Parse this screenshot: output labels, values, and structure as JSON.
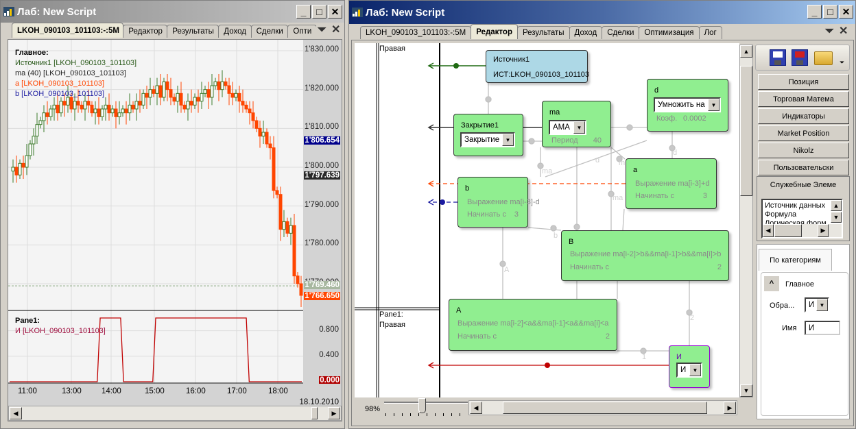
{
  "left_window": {
    "title": "Лаб: New Script",
    "tabs": [
      "LKOH_090103_101103:-:5M",
      "Редактор",
      "Результаты",
      "Доход",
      "Сделки",
      "Опти"
    ],
    "active_tab": 0,
    "legend_main": {
      "title": "Главное:",
      "items": [
        "Источник1 [LKOH_090103_101103]",
        "ma (40) [LKOH_090103_101103]",
        "a [LKOH_090103_101103]",
        "b [LKOH_090103_101103]"
      ]
    },
    "legend_pane1": {
      "title": "Pane1:",
      "items": [
        "И [LKOH_090103_101103]"
      ]
    },
    "price_labels": [
      "1'830.000",
      "1'820.000",
      "1'810.000",
      "1'800.000",
      "1'790.000",
      "1'780.000",
      "1'770.000"
    ],
    "price_levels": [
      1830,
      1820,
      1810,
      1800,
      1790,
      1780,
      1770
    ],
    "price_tags": [
      {
        "text": "1'806.654",
        "bg": "#00008b",
        "value": 1806.654
      },
      {
        "text": "1'797.639",
        "bg": "#2a2a2a",
        "value": 1797.639
      },
      {
        "text": "1'769.460",
        "bg": "#a8b8a0",
        "value": 1769.46
      },
      {
        "text": "1'766.650",
        "bg": "#ff4500",
        "value": 1766.65
      }
    ],
    "pane1_labels": [
      "0.800",
      "0.400"
    ],
    "pane1_tag": "0.000",
    "time_labels": [
      "11:00",
      "13:00",
      "14:00",
      "15:00",
      "16:00",
      "17:00",
      "18:00"
    ],
    "date_label": "18.10.2010",
    "closes": [
      1799,
      1800,
      1798,
      1801,
      1800,
      1803,
      1806,
      1808,
      1811,
      1812,
      1814,
      1813,
      1815,
      1816,
      1814,
      1817,
      1816,
      1818,
      1815,
      1817,
      1816,
      1815,
      1817,
      1816,
      1814,
      1815,
      1813,
      1815,
      1816,
      1814,
      1815,
      1813,
      1814,
      1815,
      1814,
      1816,
      1815,
      1817,
      1816,
      1819,
      1818,
      1820,
      1819,
      1821,
      1818,
      1822,
      1820,
      1818,
      1817,
      1819,
      1816,
      1815,
      1817,
      1816,
      1818,
      1817,
      1819,
      1820,
      1818,
      1821,
      1822,
      1820,
      1822,
      1821,
      1819,
      1818,
      1819,
      1817,
      1816,
      1815,
      1814,
      1812,
      1810,
      1808,
      1809,
      1806,
      1805,
      1794,
      1793,
      1784,
      1786,
      1783,
      1785,
      1772,
      1770,
      1767
    ],
    "signal": [
      [
        0,
        0
      ],
      [
        0.3,
        0
      ],
      [
        0.31,
        1
      ],
      [
        0.38,
        1
      ],
      [
        0.39,
        0
      ],
      [
        0.49,
        0
      ],
      [
        0.5,
        1
      ],
      [
        0.81,
        1
      ],
      [
        0.82,
        0
      ],
      [
        1,
        0
      ]
    ],
    "colors": {
      "up": "#3a7a2a",
      "down": "#ff4500",
      "ma": "#222222",
      "a": "#ff4500",
      "b": "#1a1aa0",
      "signal": "#c00000"
    }
  },
  "right_window": {
    "title": "Лаб: New Script",
    "tabs": [
      "LKOH_090103_101103:-:5M",
      "Редактор",
      "Результаты",
      "Доход",
      "Сделки",
      "Оптимизация",
      "Лог"
    ],
    "active_tab": 1,
    "lanes": {
      "top": "Правая",
      "pane1_title": "Pane1:",
      "pane1_sub": "Правая"
    },
    "nodes": {
      "source": {
        "title": "Источник1",
        "value": "ИСТ:LKOH_090103_101103"
      },
      "close": {
        "title": "Закрытие1",
        "select": "Закрытие"
      },
      "ma": {
        "title": "ma",
        "select": "AMA",
        "param": "Период",
        "value": "40"
      },
      "d": {
        "title": "d",
        "select": "Умножить на",
        "param": "Коэф.",
        "value": "0.0002"
      },
      "a": {
        "title": "a",
        "expr": "Выражение ma[i-3]+d",
        "param": "Начинать с",
        "value": "3"
      },
      "b": {
        "title": "b",
        "expr": "Выражение ma[i-3]-d",
        "param": "Начинать с",
        "value": "3"
      },
      "B": {
        "title": "B",
        "expr": "Выражение ma[i-2]>b&&ma[i-1]>b&&ma[i]>b",
        "param": "Начинать с",
        "value": "2"
      },
      "A": {
        "title": "A",
        "expr": "Выражение ma[i-2]<a&&ma[i-1]<a&&ma[i]<a",
        "param": "Начинать с",
        "value": "2"
      },
      "and": {
        "title": "И",
        "select": "И"
      }
    },
    "edge_labels": [
      "ma",
      "d",
      "m",
      "ma",
      "b",
      "A",
      "2",
      "1",
      "d"
    ],
    "zoom_label": "98%",
    "zoom_value": 0.45,
    "toolbox": {
      "icons": [
        "save-icon",
        "save-as-icon",
        "open-folder-icon"
      ],
      "categories": [
        "Позиция",
        "Торговая Матема",
        "Индикаторы",
        "Market Position",
        "Nikolz",
        "Пользовательски"
      ],
      "open_category": "Служебные Элеме",
      "list_items": [
        "Источник данных",
        "Формула",
        "Логическая форм"
      ]
    },
    "properties": {
      "tab": "По категориям",
      "group": "Главное",
      "fields": [
        {
          "label": "Обра...",
          "value": "И"
        },
        {
          "label": "Имя",
          "value": "И"
        }
      ]
    }
  }
}
